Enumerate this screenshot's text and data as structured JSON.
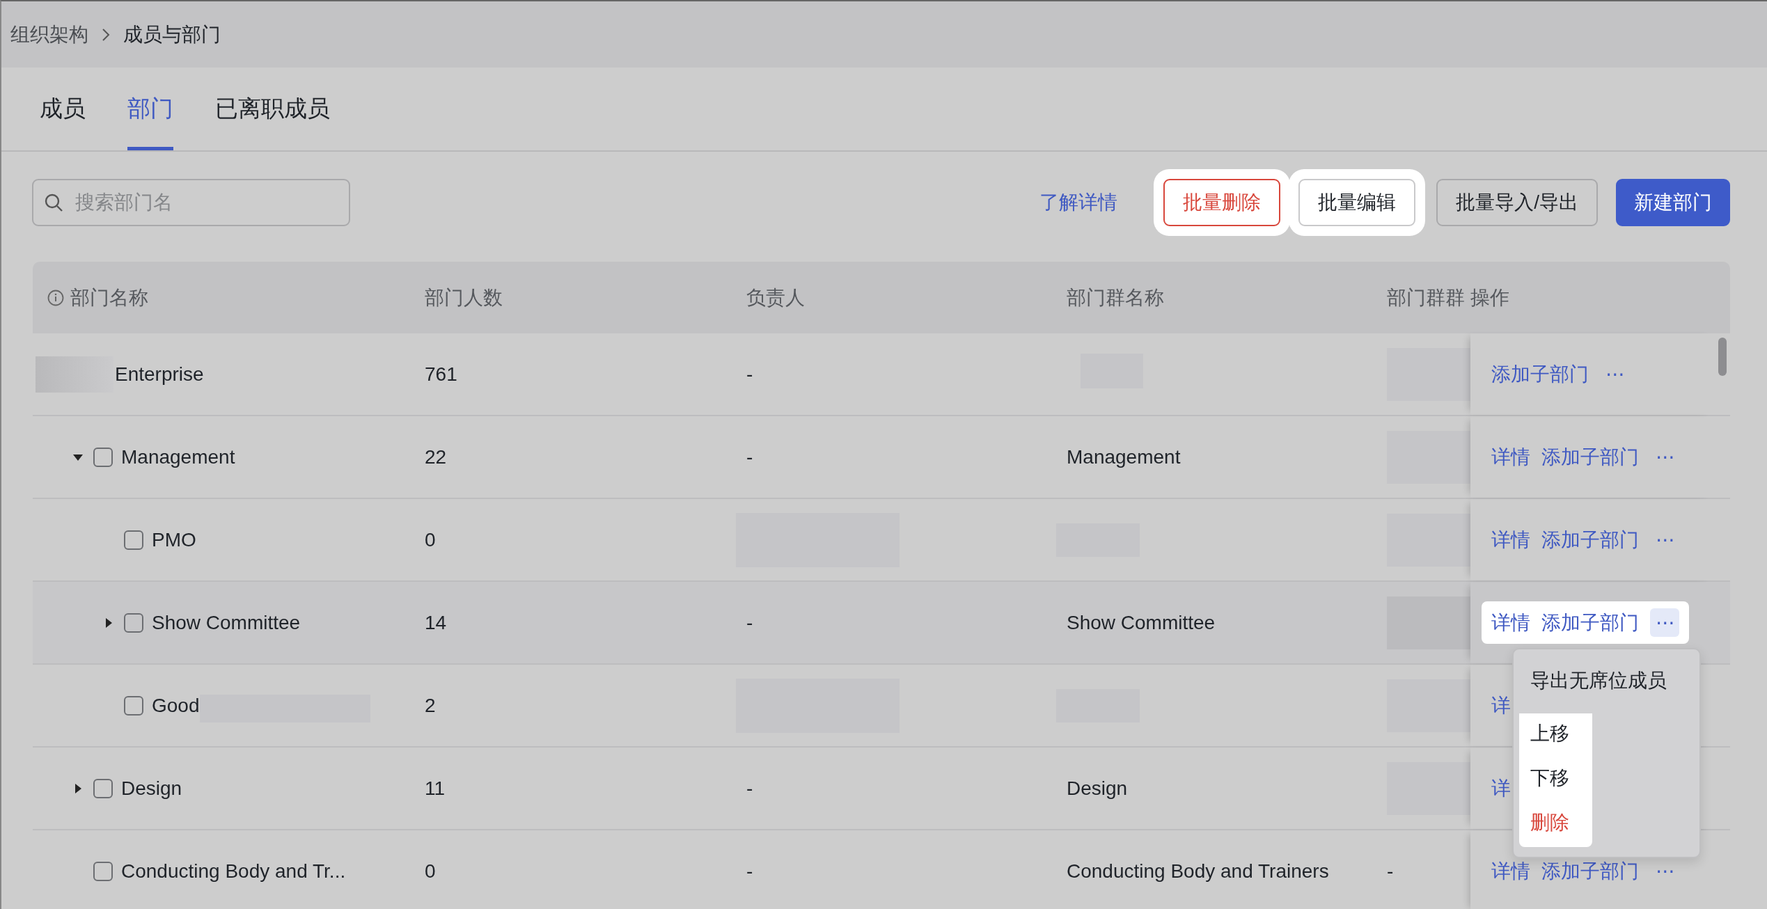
{
  "breadcrumb": [
    "组织架构",
    "成员与部门"
  ],
  "tabs": [
    {
      "label": "成员",
      "selected": false
    },
    {
      "label": "部门",
      "selected": true
    },
    {
      "label": "已离职成员",
      "selected": false
    }
  ],
  "search": {
    "placeholder": "搜索部门名"
  },
  "help_link": "了解详情",
  "toolbar_buttons": [
    {
      "label": "批量删除",
      "kind": "danger",
      "highlighted": true
    },
    {
      "label": "批量编辑",
      "kind": "default",
      "highlighted": true
    },
    {
      "label": "批量导入/导出",
      "kind": "default",
      "highlighted": false
    },
    {
      "label": "新建部门",
      "kind": "primary",
      "highlighted": false
    }
  ],
  "table": {
    "columns": [
      "部门名称",
      "部门人数",
      "负责人",
      "部门群名称",
      "部门群群",
      "操作"
    ],
    "rows": [
      {
        "kind": "root",
        "name": "Enterprise",
        "name_masked": false,
        "count": "761",
        "owner": "-",
        "actions": [
          "添加子部门",
          "⋯"
        ],
        "highlighted": false,
        "hovered": false,
        "children": [
          {
            "kind": "branch",
            "expanded": true,
            "checked": false,
            "name": "Management",
            "name_masked": false,
            "count": "22",
            "owner": "-",
            "group_name": "Management",
            "actions": [
              "详情",
              "添加子部门",
              "⋯"
            ],
            "highlighted": false,
            "hovered": false,
            "children": [
              {
                "kind": "leaf",
                "checked": false,
                "name": "PMO",
                "name_masked": false,
                "count": "0",
                "actions": [
                  "详情",
                  "添加子部门",
                  "⋯"
                ],
                "highlighted": false,
                "hovered": false
              },
              {
                "kind": "branch",
                "expanded": false,
                "checked": false,
                "name": "Show Committee",
                "name_masked": false,
                "count": "14",
                "owner": "-",
                "group_name": "Show Committee",
                "actions": [
                  "详情",
                  "添加子部门",
                  "⋯"
                ],
                "highlighted": true,
                "hovered": true
              },
              {
                "kind": "leaf",
                "checked": false,
                "name": "Good",
                "name_masked": true,
                "count": "2",
                "actions": [
                  "详"
                ],
                "highlighted": false,
                "hovered": false
              }
            ]
          },
          {
            "kind": "branch",
            "expanded": false,
            "checked": false,
            "name": "Design",
            "name_masked": false,
            "count": "11",
            "owner": "-",
            "group_name": "Design",
            "actions": [
              "详"
            ],
            "highlighted": false,
            "hovered": false
          },
          {
            "kind": "leaf",
            "checked": false,
            "name": "Conducting Body and Tr...",
            "name_masked": false,
            "count": "0",
            "owner": "-",
            "group_name": "Conducting Body and Trainers",
            "group": "-",
            "actions": [
              "详情",
              "添加子部门",
              "⋯"
            ],
            "highlighted": false,
            "hovered": false
          }
        ]
      }
    ]
  },
  "row_menu": {
    "items": [
      {
        "label": "导出无席位成员",
        "kind": "normal",
        "highlighted": false
      },
      {
        "label": "上移",
        "kind": "normal",
        "highlighted": true
      },
      {
        "label": "下移",
        "kind": "normal",
        "highlighted": true
      },
      {
        "label": "删除",
        "kind": "danger",
        "highlighted": true
      }
    ]
  }
}
